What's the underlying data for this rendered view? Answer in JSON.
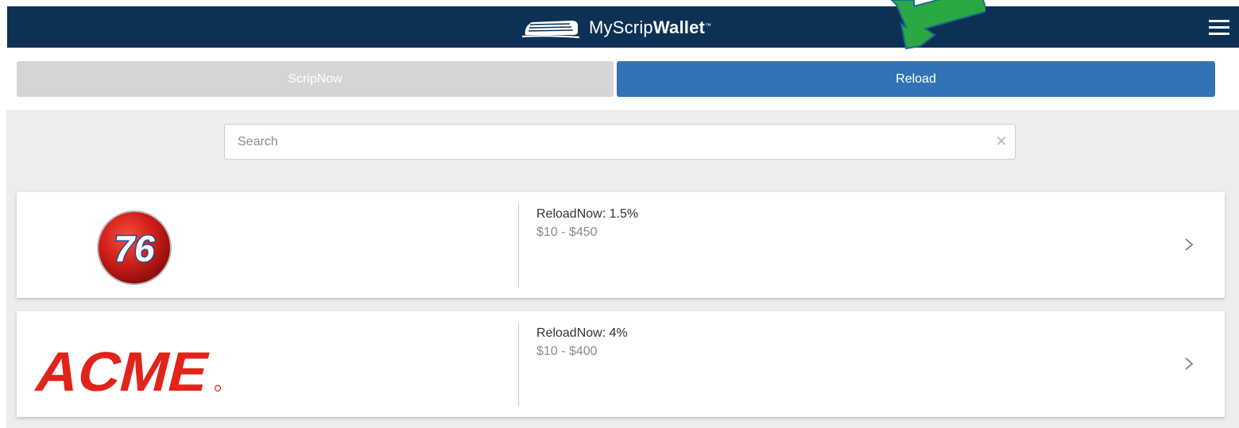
{
  "app": {
    "brand_light": "MyScrip",
    "brand_bold": "Wallet",
    "brand_tm": "™"
  },
  "header": {
    "menu_icon": "hamburger-menu-icon"
  },
  "tabs": [
    {
      "label": "ScripNow",
      "active": false
    },
    {
      "label": "Reload",
      "active": true
    }
  ],
  "search": {
    "placeholder": "Search",
    "value": "",
    "clear_icon": "close-icon"
  },
  "merchants": [
    {
      "logo_text": "76",
      "rate": "ReloadNow: 1.5%",
      "range": "$10 - $450"
    },
    {
      "logo_text": "ACME",
      "rate": "ReloadNow: 4%",
      "range": "$10 - $400"
    }
  ],
  "colors": {
    "header_bg": "#0d3155",
    "tab_active": "#3273b5",
    "tab_inactive": "#d4d5d7",
    "content_bg": "#ecedee",
    "acme_red": "#e2231a",
    "arrow_green": "#2aa843"
  }
}
